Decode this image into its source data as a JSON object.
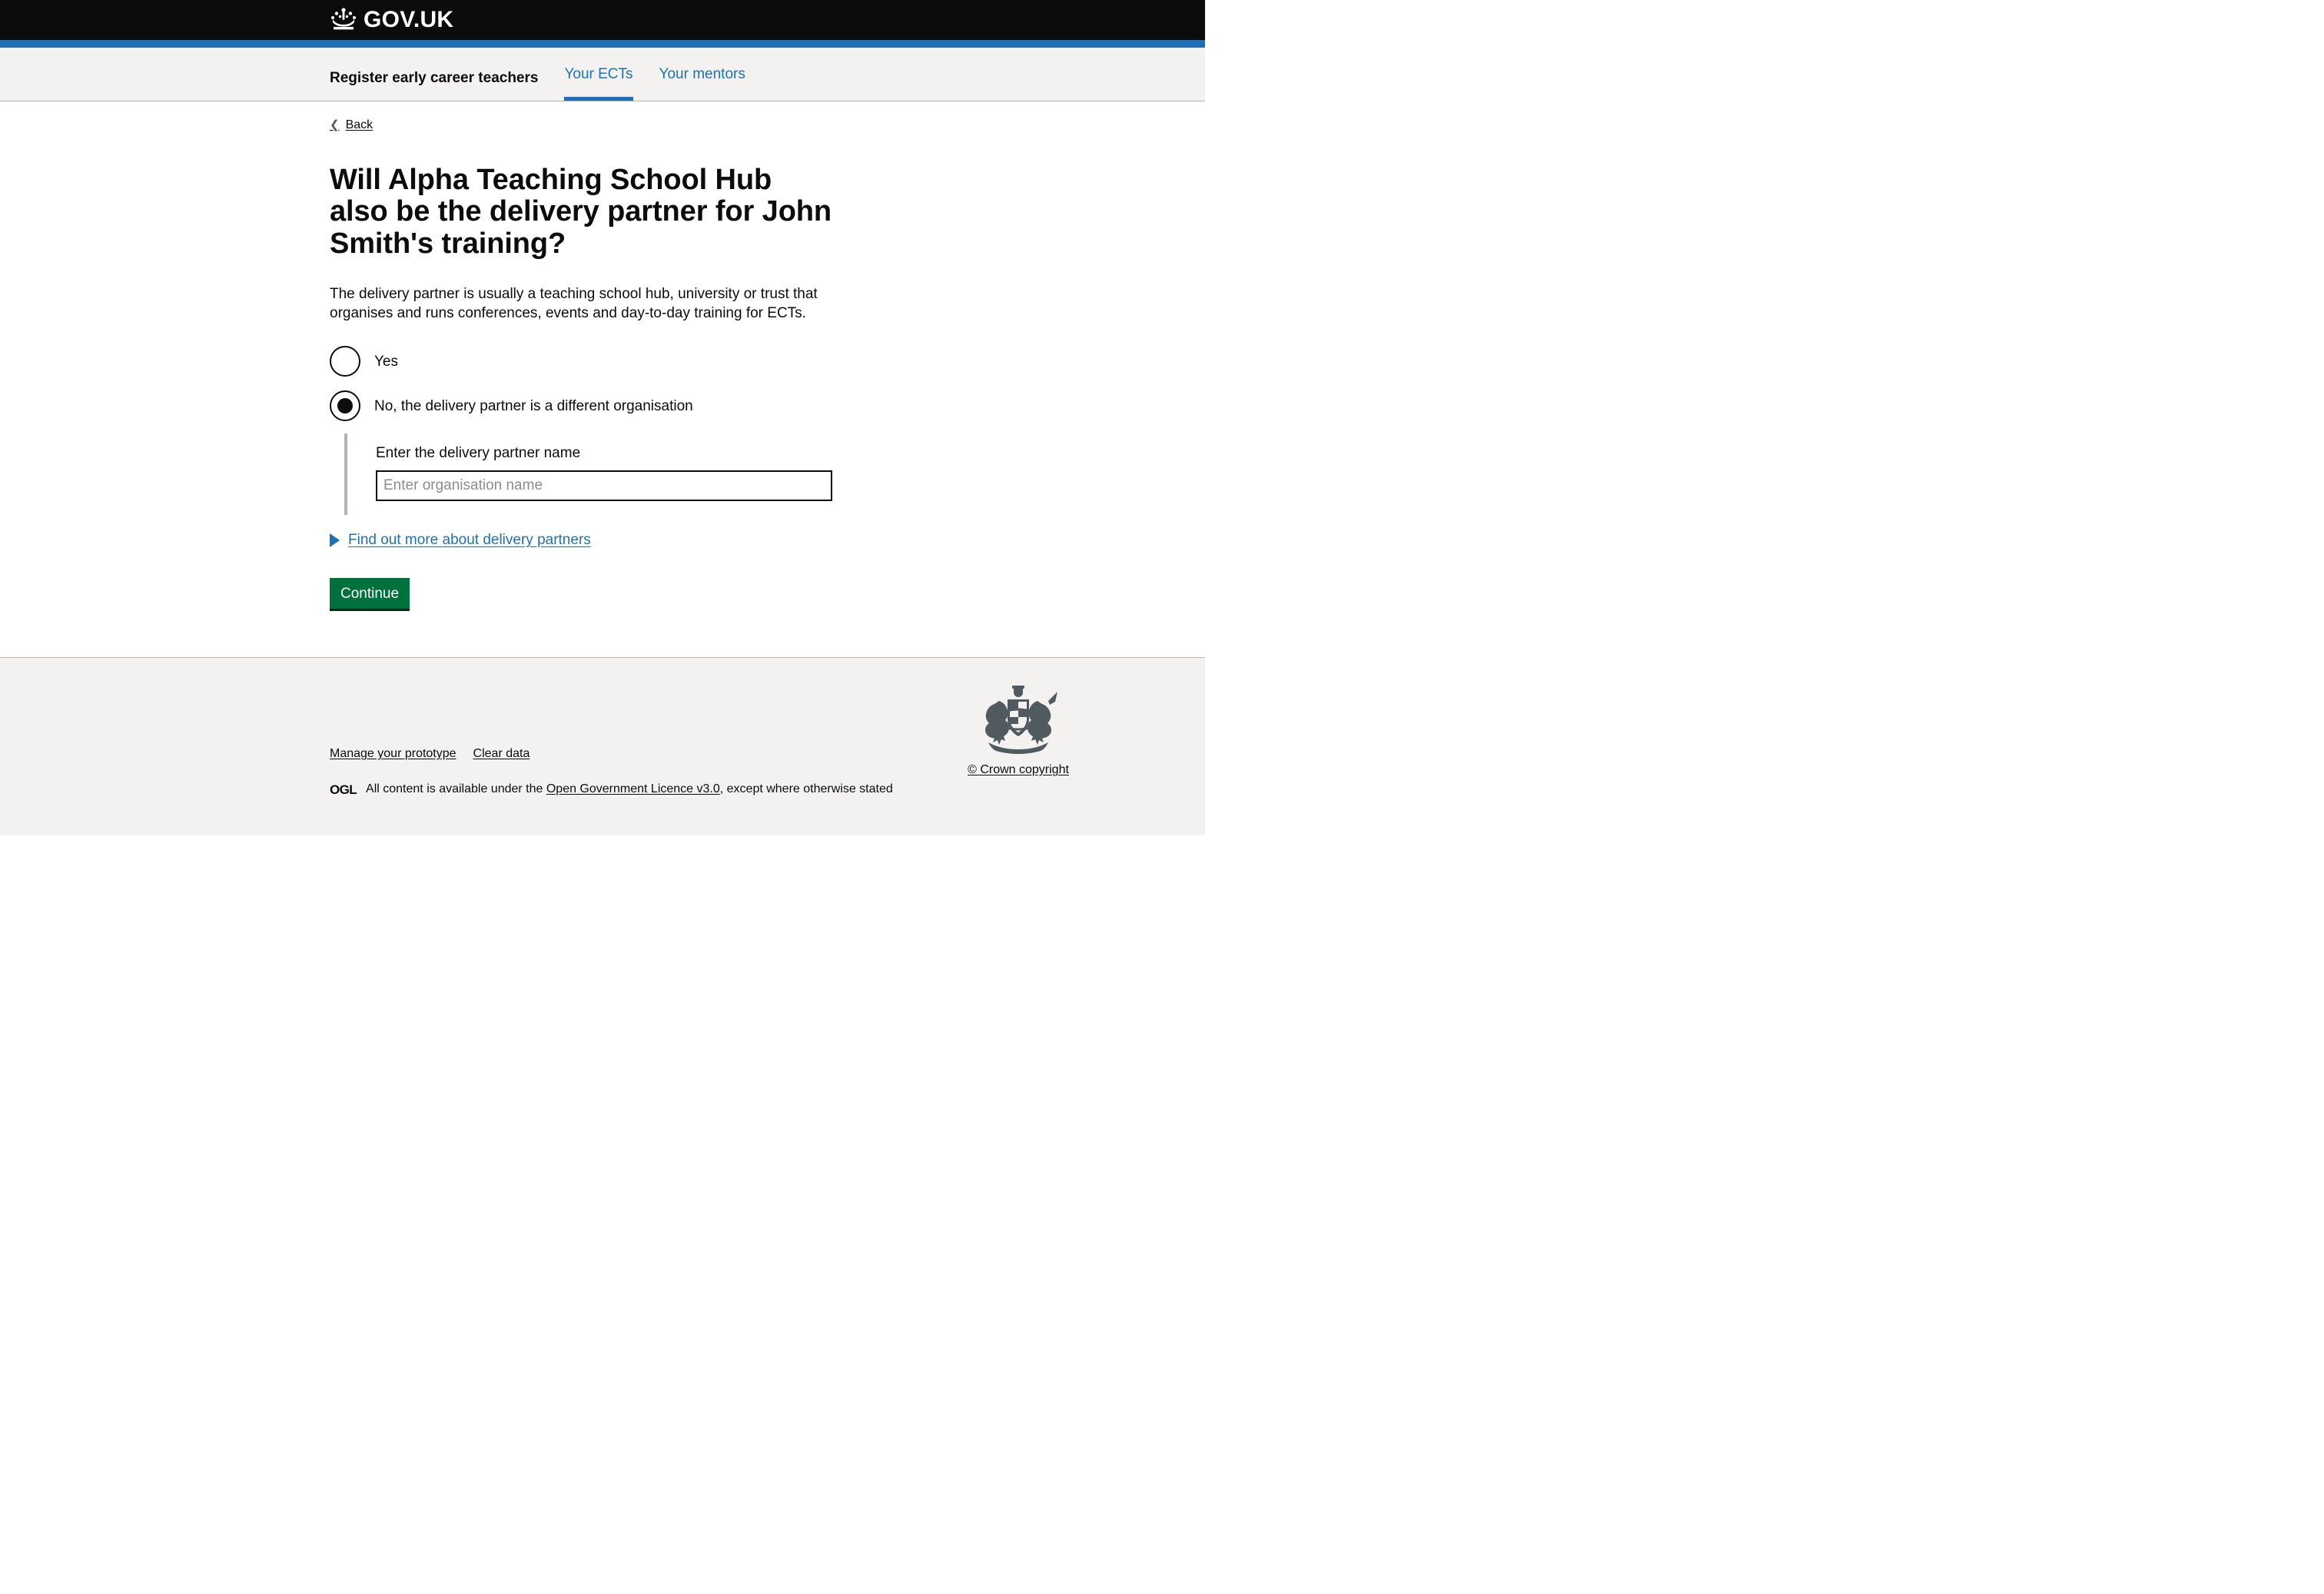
{
  "header": {
    "crown_icon": "crown-icon",
    "brand_text": "GOV.UK"
  },
  "service_nav": {
    "service_name": "Register early career teachers",
    "items": [
      {
        "label": "Your ECTs",
        "active": true
      },
      {
        "label": "Your mentors",
        "active": false
      }
    ],
    "active_color": "#1d70b8"
  },
  "back": {
    "label": "Back",
    "chevron_icon": "chevron-left-icon"
  },
  "main": {
    "heading": "Will Alpha Teaching School Hub also be the delivery partner for John Smith's training?",
    "hint": "The delivery partner is usually a teaching school hub, university or trust that organises and runs conferences, events and day-to-day training for ECTs.",
    "radios": [
      {
        "label": "Yes",
        "checked": false
      },
      {
        "label": "No, the delivery partner is a different organisation",
        "checked": true
      }
    ],
    "conditional": {
      "label": "Enter the delivery partner name",
      "input_value": "",
      "input_placeholder": "Enter organisation name"
    },
    "details": {
      "arrow_icon": "triangle-right-icon",
      "label": "Find out more about delivery partners"
    },
    "continue_label": "Continue"
  },
  "footer": {
    "links": [
      {
        "label": "Manage your prototype"
      },
      {
        "label": "Clear data"
      }
    ],
    "ogl_logo": "OGL",
    "licence_prefix": "All content is available under the ",
    "licence_link": "Open Government Licence v3.0",
    "licence_suffix": ", except where otherwise stated",
    "crown_icon": "royal-coat-of-arms-icon",
    "crown_copyright": "© Crown copyright"
  },
  "colors": {
    "black": "#0b0c0c",
    "blue": "#1d70b8",
    "green": "#00703c",
    "grey_bg": "#f3f2f1",
    "border_grey": "#b1b4b6"
  }
}
